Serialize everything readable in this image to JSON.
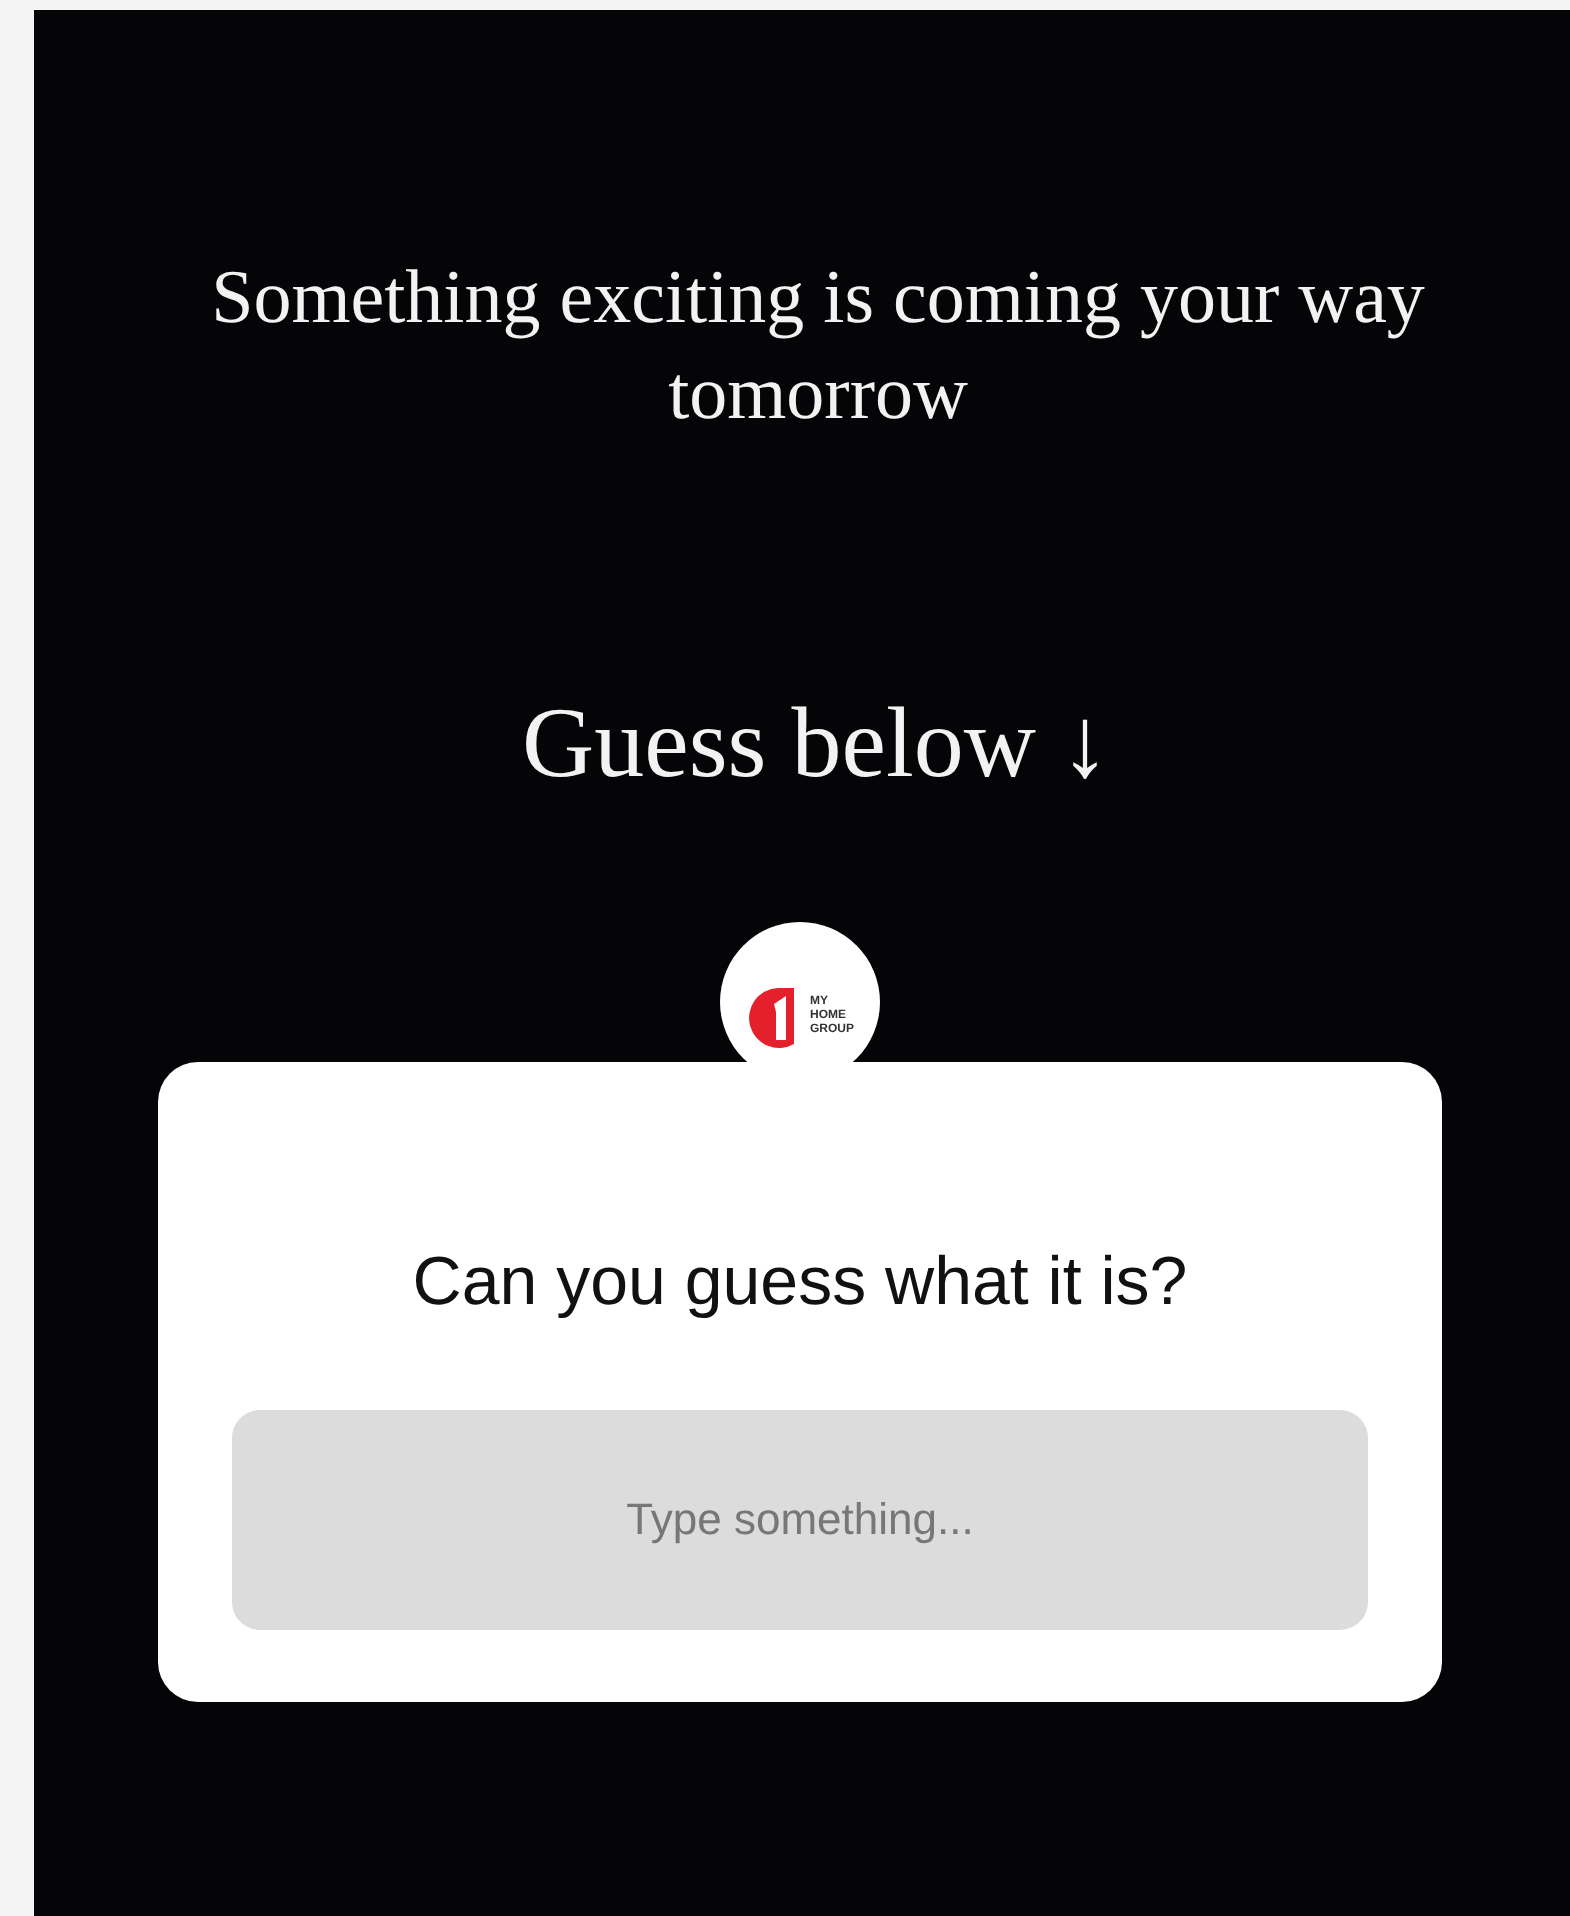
{
  "story": {
    "caption": "Something exciting is coming your way tomorrow",
    "prompt": "Guess below",
    "arrow": "↓"
  },
  "question_sticker": {
    "logo_text": [
      "MY",
      "HOME",
      "GROUP"
    ],
    "question": "Can you guess what it is?",
    "answer": {
      "placeholder": "Type something..."
    }
  }
}
